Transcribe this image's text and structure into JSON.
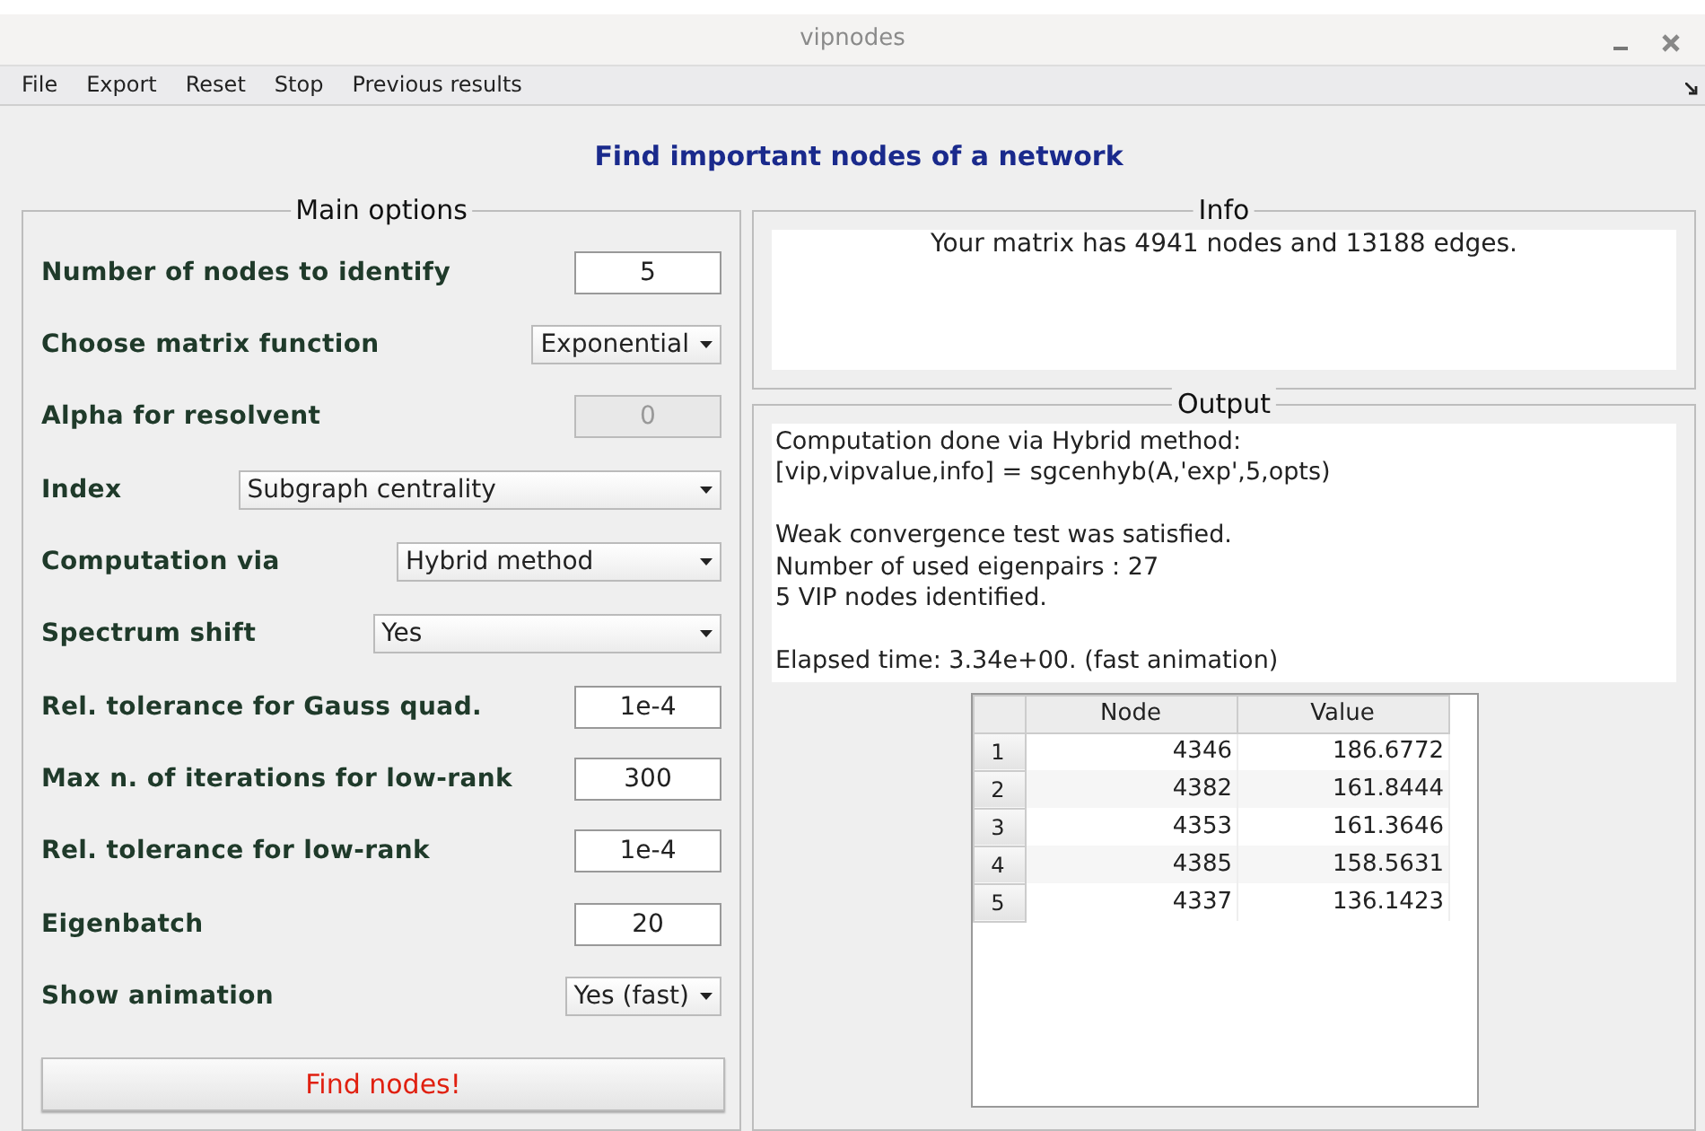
{
  "window": {
    "title": "vipnodes"
  },
  "menu": [
    "File",
    "Export",
    "Reset",
    "Stop",
    "Previous results"
  ],
  "heading": "Find important nodes of a network",
  "main_options": {
    "title": "Main options",
    "options": [
      {
        "label": "Number of nodes to identify",
        "kind": "input",
        "value": "5",
        "disabled": false
      },
      {
        "label": "Choose matrix function",
        "kind": "compact_dropdown",
        "value": "Exponential"
      },
      {
        "label": "Alpha for resolvent",
        "kind": "input",
        "value": "0",
        "disabled": true
      },
      {
        "label": "Index",
        "kind": "dropdown",
        "value": "Subgraph centrality"
      },
      {
        "label": "Computation via",
        "kind": "dropdown",
        "value": "Hybrid method"
      },
      {
        "label": "Spectrum shift",
        "kind": "dropdown",
        "value": "Yes"
      },
      {
        "label": "Rel. tolerance for Gauss quad.",
        "kind": "input",
        "value": "1e-4",
        "disabled": false
      },
      {
        "label": "Max n. of iterations for low-rank",
        "kind": "input",
        "value": "300",
        "disabled": false
      },
      {
        "label": "Rel. tolerance for low-rank",
        "kind": "input",
        "value": "1e-4",
        "disabled": false
      },
      {
        "label": "Eigenbatch",
        "kind": "input",
        "value": "20",
        "disabled": false
      },
      {
        "label": "Show animation",
        "kind": "compact_dropdown",
        "value": "Yes (fast)"
      }
    ],
    "button": "Find nodes!"
  },
  "info": {
    "title": "Info",
    "text": "Your matrix has 4941 nodes and 13188 edges."
  },
  "output": {
    "title": "Output",
    "paragraphs": [
      [
        "Computation done via Hybrid method:",
        "[vip,vipvalue,info] = sgcenhyb(A,'exp',5,opts)"
      ],
      [
        "Weak convergence test was satisfied.",
        "Number of used eigenpairs : 27",
        "5 VIP nodes identified."
      ],
      [
        "Elapsed time: 3.34e+00. (fast animation)"
      ]
    ],
    "table": {
      "columns": [
        "Node",
        "Value"
      ],
      "rows": [
        {
          "index": "1",
          "node": "4346",
          "value": "186.6772"
        },
        {
          "index": "2",
          "node": "4382",
          "value": "161.8444"
        },
        {
          "index": "3",
          "node": "4353",
          "value": "161.3646"
        },
        {
          "index": "4",
          "node": "4385",
          "value": "158.5631"
        },
        {
          "index": "5",
          "node": "4337",
          "value": "136.1423"
        }
      ]
    }
  }
}
